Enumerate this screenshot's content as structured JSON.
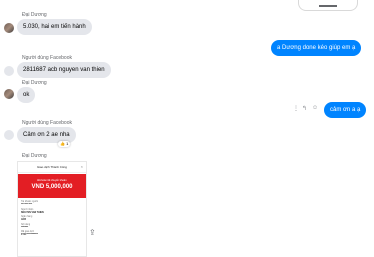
{
  "messages": [
    {
      "sender": "Đại Dương",
      "text": "5.030, hai em tiến hành"
    },
    {
      "text": "a Dương done kéo giúp em ạ"
    },
    {
      "sender": "Người dùng Facebook",
      "text": "2811687 acb nguyen van thien"
    },
    {
      "sender": "Đại Dương",
      "text": "ok"
    },
    {
      "text": "cảm ơn a ạ"
    },
    {
      "sender": "Người dùng Facebook",
      "text": "Cảm ơn 2 ae nha",
      "reaction": "👍 1"
    },
    {
      "sender": "Đại Dương"
    }
  ],
  "actions": {
    "more": "⋮",
    "reply": "↰",
    "emoji": "☺"
  },
  "receipt": {
    "title": "Giao dịch Thành Công",
    "close": "×",
    "status": "Đã hoàn tất chuyển khoản",
    "amount": "VND 5,000,000",
    "rows": [
      {
        "label": "Tài khoản nguồn",
        "value": "*** **** ****"
      },
      {
        "label": "Người nhận",
        "value": "NGUYEN VAN THIEN"
      },
      {
        "label": "Ngân hàng",
        "value": "ACB"
      },
      {
        "label": "Nội dung",
        "value": "********"
      },
      {
        "label": "Mã giao dịch",
        "value": "FT21*************"
      }
    ]
  },
  "share_icon": "⇪"
}
